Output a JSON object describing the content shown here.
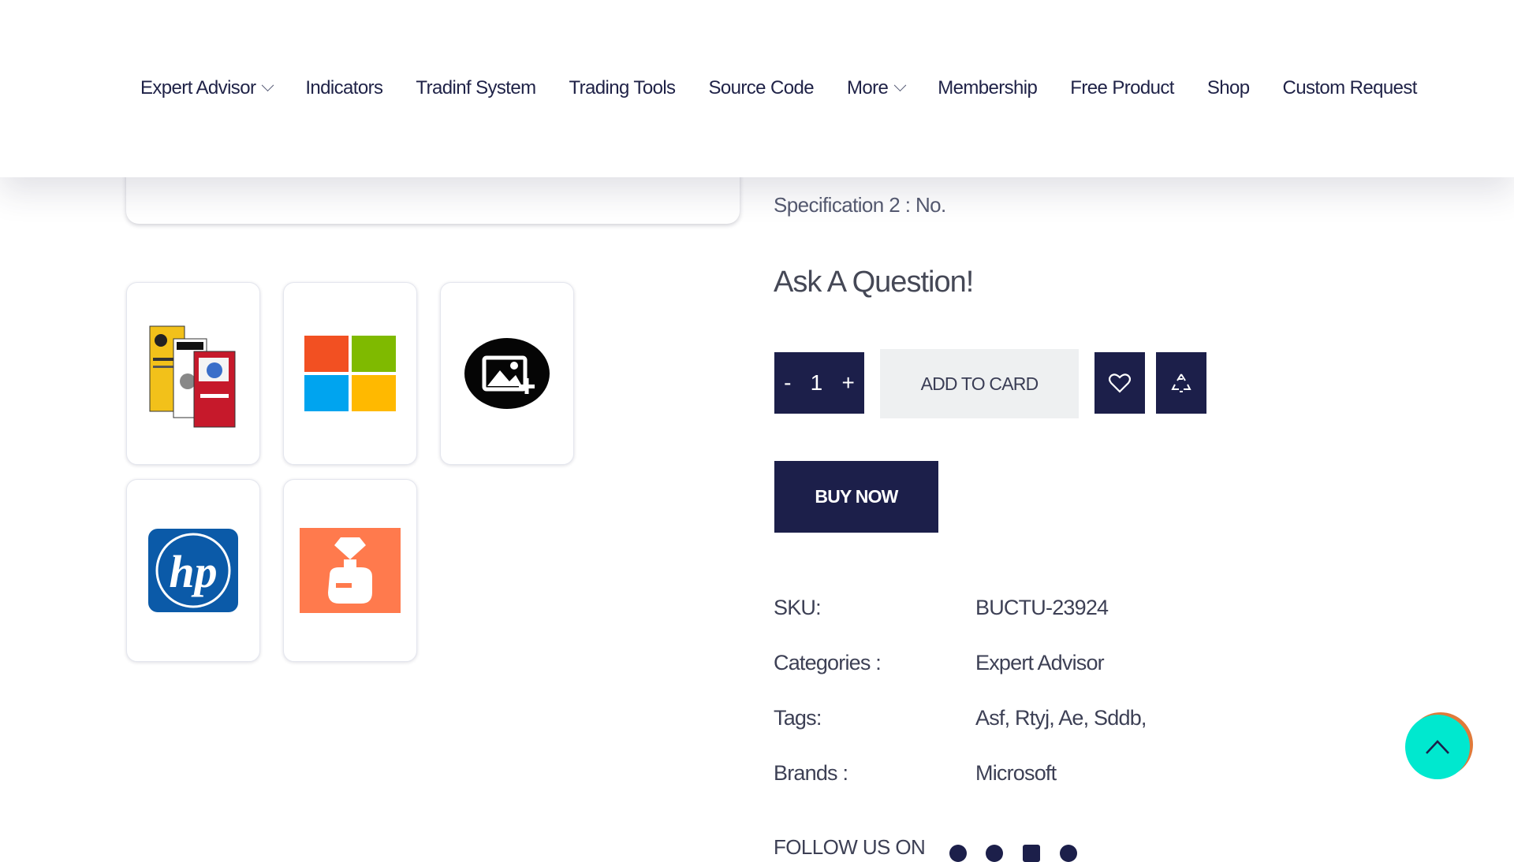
{
  "nav": {
    "items": [
      {
        "label": "Expert Advisor",
        "dropdown": true
      },
      {
        "label": "Indicators",
        "dropdown": false
      },
      {
        "label": "Tradinf System",
        "dropdown": false
      },
      {
        "label": "Trading Tools",
        "dropdown": false
      },
      {
        "label": "Source Code",
        "dropdown": false
      },
      {
        "label": "More",
        "dropdown": true
      },
      {
        "label": "Membership",
        "dropdown": false
      },
      {
        "label": "Free Product",
        "dropdown": false
      },
      {
        "label": "Shop",
        "dropdown": false
      },
      {
        "label": "Custom Request",
        "dropdown": false
      }
    ]
  },
  "gallery": {
    "thumbnails": [
      {
        "icon": "software-boxes-icon"
      },
      {
        "icon": "microsoft-logo-icon"
      },
      {
        "icon": "add-image-icon"
      },
      {
        "icon": "hp-logo-icon"
      },
      {
        "icon": "perfume-bottle-icon"
      }
    ]
  },
  "product": {
    "spec2": "Specification 2 : No.",
    "ask_question": "Ask A Question!",
    "quantity": {
      "minus": "-",
      "value": "1",
      "plus": "+"
    },
    "add_to_card": "ADD TO CARD",
    "buy_now": "BUY NOW",
    "meta": {
      "sku_label": "SKU:",
      "sku_value": "BUCTU-23924",
      "categories_label": "Categories :",
      "categories_value": "Expert Advisor",
      "tags_label": "Tags:",
      "tags_value": "Asf, Rtyj, Ae, Sddb,",
      "brands_label": "Brands :",
      "brands_value": "Microsoft"
    },
    "follow_us": "FOLLOW US ON"
  },
  "colors": {
    "navy": "#1c1f4a",
    "scroll_top": "#00e8cf",
    "scroll_top_accent": "#e07a3a"
  }
}
